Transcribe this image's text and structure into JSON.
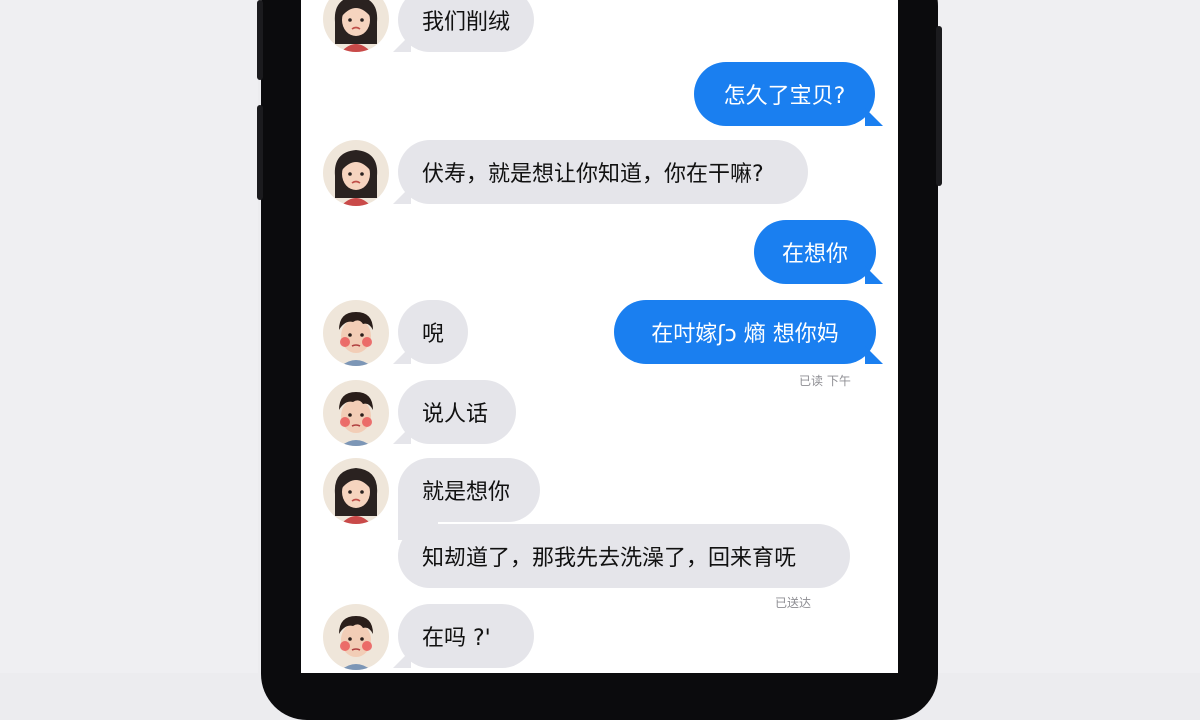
{
  "messages": [
    {
      "text": "我们削绒"
    },
    {
      "text": "怎久了宝贝?"
    },
    {
      "text": "伏寿，就是想让你知道，你在干嘛?"
    },
    {
      "text": "在想你"
    },
    {
      "text": "唲"
    },
    {
      "text": "在吋嫁ʃɔ 熵  想你妈"
    },
    {
      "text": "说人话"
    },
    {
      "text": "就是想你"
    },
    {
      "text": "知刼道了，那我先去洗澡了，回来育呒"
    },
    {
      "text": "在吗  ?'"
    }
  ],
  "meta": {
    "read_receipt": "已读 下午",
    "delivered": "已送达"
  },
  "colors": {
    "outgoing": "#1a7ff0",
    "incoming": "#e5e5ea",
    "background": "#ffffff"
  },
  "icons": {
    "avatar_girl": "girl-avatar-icon",
    "avatar_boy": "boy-avatar-icon"
  }
}
